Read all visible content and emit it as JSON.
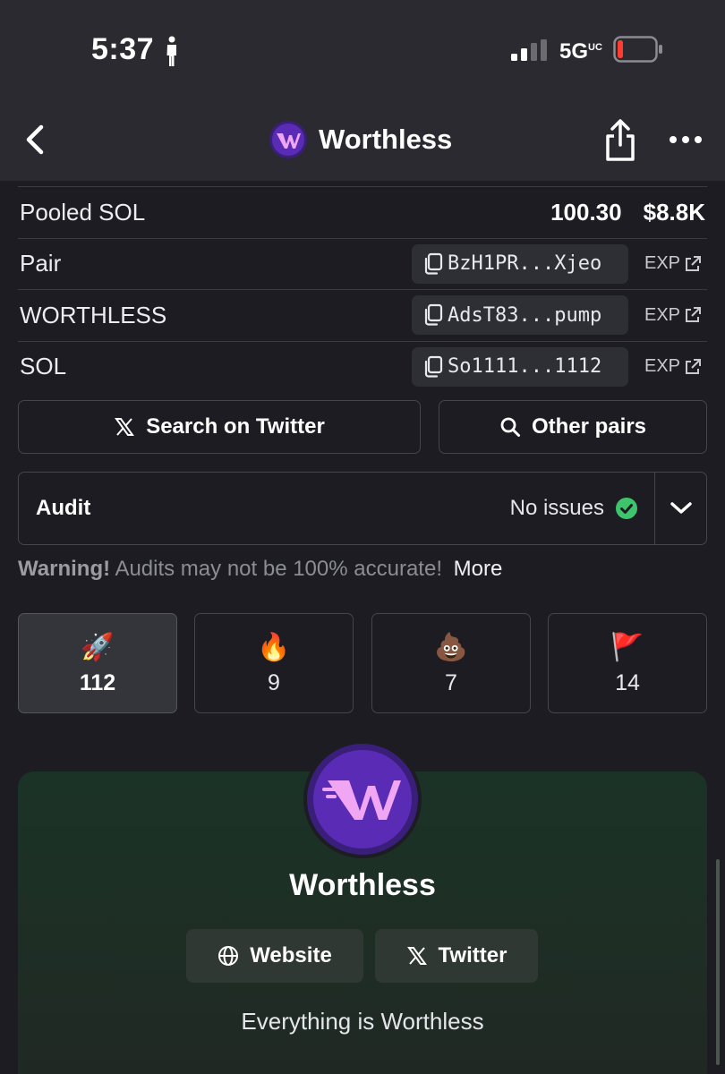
{
  "status_bar": {
    "time": "5:37",
    "network": "5G",
    "network_suffix": "UC"
  },
  "header": {
    "title": "Worthless"
  },
  "pooled": {
    "label": "Pooled SOL",
    "amount": "100.30",
    "usd": "$8.8K"
  },
  "addresses": [
    {
      "label": "Pair",
      "address": "BzH1PR...Xjeo",
      "link": "EXP"
    },
    {
      "label": "WORTHLESS",
      "address": "AdsT83...pump",
      "link": "EXP"
    },
    {
      "label": "SOL",
      "address": "So1111...1112",
      "link": "EXP"
    }
  ],
  "actions": {
    "search_twitter": "Search on Twitter",
    "other_pairs": "Other pairs"
  },
  "audit": {
    "label": "Audit",
    "status": "No issues"
  },
  "warning": {
    "strong": "Warning!",
    "text": "Audits may not be 100% accurate!",
    "more": "More"
  },
  "reactions": [
    {
      "emoji": "🚀",
      "count": "112",
      "active": true
    },
    {
      "emoji": "🔥",
      "count": "9",
      "active": false
    },
    {
      "emoji": "💩",
      "count": "7",
      "active": false
    },
    {
      "emoji": "🚩",
      "count": "14",
      "active": false
    }
  ],
  "token": {
    "name": "Worthless",
    "website_label": "Website",
    "twitter_label": "Twitter",
    "tagline": "Everything is Worthless"
  },
  "colors": {
    "background": "#1c1c22",
    "header": "#2a2a30",
    "logo_purple": "#5a2bb5",
    "logo_pink": "#f0a6f2",
    "check_green": "#3ec46d",
    "battery_red": "#ff3b30"
  }
}
